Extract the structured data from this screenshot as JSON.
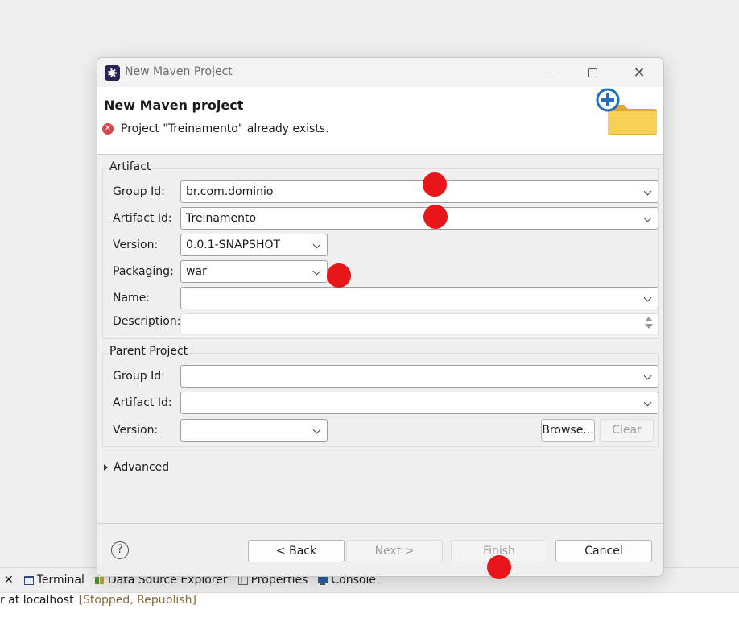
{
  "dialog": {
    "title": "New Maven Project",
    "page_title": "New Maven project",
    "error_message": "Project \"Treinamento\" already exists."
  },
  "artifact": {
    "section_label": "Artifact",
    "group_id_label": "Group Id:",
    "group_id": "br.com.dominio",
    "artifact_id_label": "Artifact Id:",
    "artifact_id": "Treinamento",
    "version_label": "Version:",
    "version": "0.0.1-SNAPSHOT",
    "packaging_label": "Packaging:",
    "packaging": "war",
    "name_label": "Name:",
    "name": "",
    "description_label": "Description:",
    "description": ""
  },
  "parent": {
    "section_label": "Parent Project",
    "group_id_label": "Group Id:",
    "group_id": "",
    "artifact_id_label": "Artifact Id:",
    "artifact_id": "",
    "version_label": "Version:",
    "version": "",
    "browse_label": "Browse...",
    "clear_label": "Clear"
  },
  "advanced_label": "Advanced",
  "buttons": {
    "help": "?",
    "back": "< Back",
    "next": "Next >",
    "finish": "Finish",
    "cancel": "Cancel"
  },
  "ide": {
    "tabs": [
      "Terminal",
      "Data Source Explorer",
      "Properties",
      "Console"
    ],
    "server_text": "r at localhost",
    "server_state": "[Stopped, Republish]"
  },
  "colors": {
    "marker": "#e8161b",
    "error": "#d9464a",
    "banner_plus": "#1f6fc0",
    "folder": "#f6c744"
  },
  "icons": {
    "app": "eclipse-icon",
    "error": "error-icon",
    "banner": "new-folder-plus-icon",
    "help": "help-icon"
  }
}
